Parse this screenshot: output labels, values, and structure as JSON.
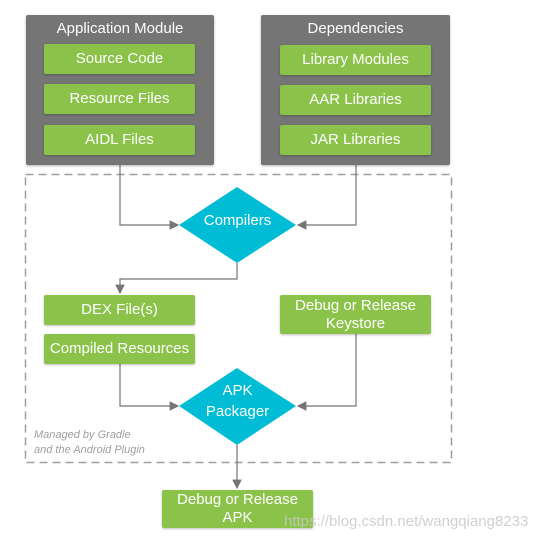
{
  "application_module": {
    "title": "Application Module",
    "items": [
      "Source Code",
      "Resource Files",
      "AIDL Files"
    ]
  },
  "dependencies": {
    "title": "Dependencies",
    "items": [
      "Library Modules",
      "AAR Libraries",
      "JAR Libraries"
    ]
  },
  "compilers": "Compilers",
  "outputs": {
    "dex": "DEX File(s)",
    "compiled_resources": "Compiled Resources",
    "keystore_line1": "Debug or Release",
    "keystore_line2": "Keystore"
  },
  "apk_packager": {
    "line1": "APK",
    "line2": "Packager"
  },
  "managed_note": {
    "line1": "Managed by Gradle",
    "line2": "and the Android Plugin"
  },
  "final_apk": {
    "line1": "Debug or Release",
    "line2": "APK"
  },
  "watermark": "https://blog.csdn.net/wangqiang8233",
  "colors": {
    "panel": "#757575",
    "green": "#8bc34a",
    "diamond": "#00bcd4",
    "line": "#757575"
  }
}
